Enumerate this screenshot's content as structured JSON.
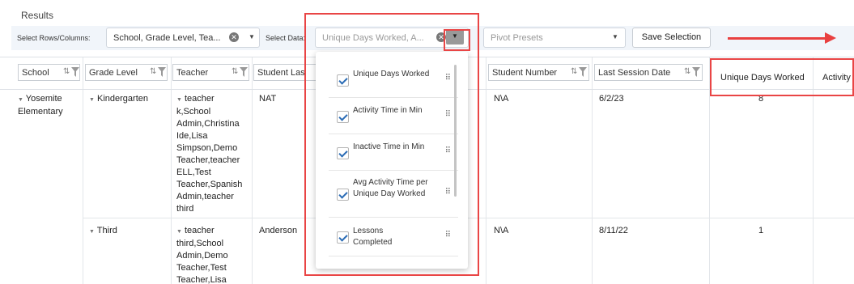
{
  "results_title": "Results",
  "toolbar": {
    "rows_label": "Select Rows/Columns:",
    "rows_value": "School, Grade Level, Tea...",
    "data_label": "Select Data:",
    "data_placeholder": "Unique Days Worked, A...",
    "pivot_placeholder": "Pivot Presets",
    "save_label": "Save Selection"
  },
  "columns": [
    {
      "label": "School"
    },
    {
      "label": "Grade Level"
    },
    {
      "label": "Teacher"
    },
    {
      "label": "Student Las"
    },
    {
      "label": "Student Number"
    },
    {
      "label": "Last Session Date"
    },
    {
      "label": "Unique Days Worked"
    },
    {
      "label": "Activity"
    }
  ],
  "rows": {
    "school": "Yosemite Elementary",
    "grade_1": "Kindergarten",
    "teacher_1": "teacher k,School Admin,Christina Ide,Lisa Simpson,Demo Teacher,teacher ELL,Test Teacher,Spanish Admin,teacher third",
    "last_1": "NAT",
    "num_1": "N\\A",
    "date_1": "6/2/23",
    "days_1": "8",
    "grade_2": "Third",
    "teacher_2": "teacher third,School Admin,Demo Teacher,Test Teacher,Lisa",
    "last_2": "Anderson",
    "num_2": "N\\A",
    "date_2": "8/11/22",
    "days_2": "1"
  },
  "dropdown_items": [
    {
      "label": "Unique Days Worked",
      "checked": true
    },
    {
      "label": "Activity Time in Min",
      "checked": true
    },
    {
      "label": "Inactive Time in Min",
      "checked": true
    },
    {
      "label": "Avg Activity Time per Unique Day Worked",
      "checked": true
    },
    {
      "label": "Lessons Completed",
      "checked": true
    }
  ],
  "colors": {
    "highlight": "#e94545",
    "toolbar_bg": "#f1f5fa",
    "check": "#2a6bb5"
  },
  "icons": [
    "clear-icon",
    "chevron-down-icon",
    "sort-icon",
    "filter-icon",
    "checkbox-icon",
    "drag-handle-icon",
    "arrow-right-icon"
  ]
}
